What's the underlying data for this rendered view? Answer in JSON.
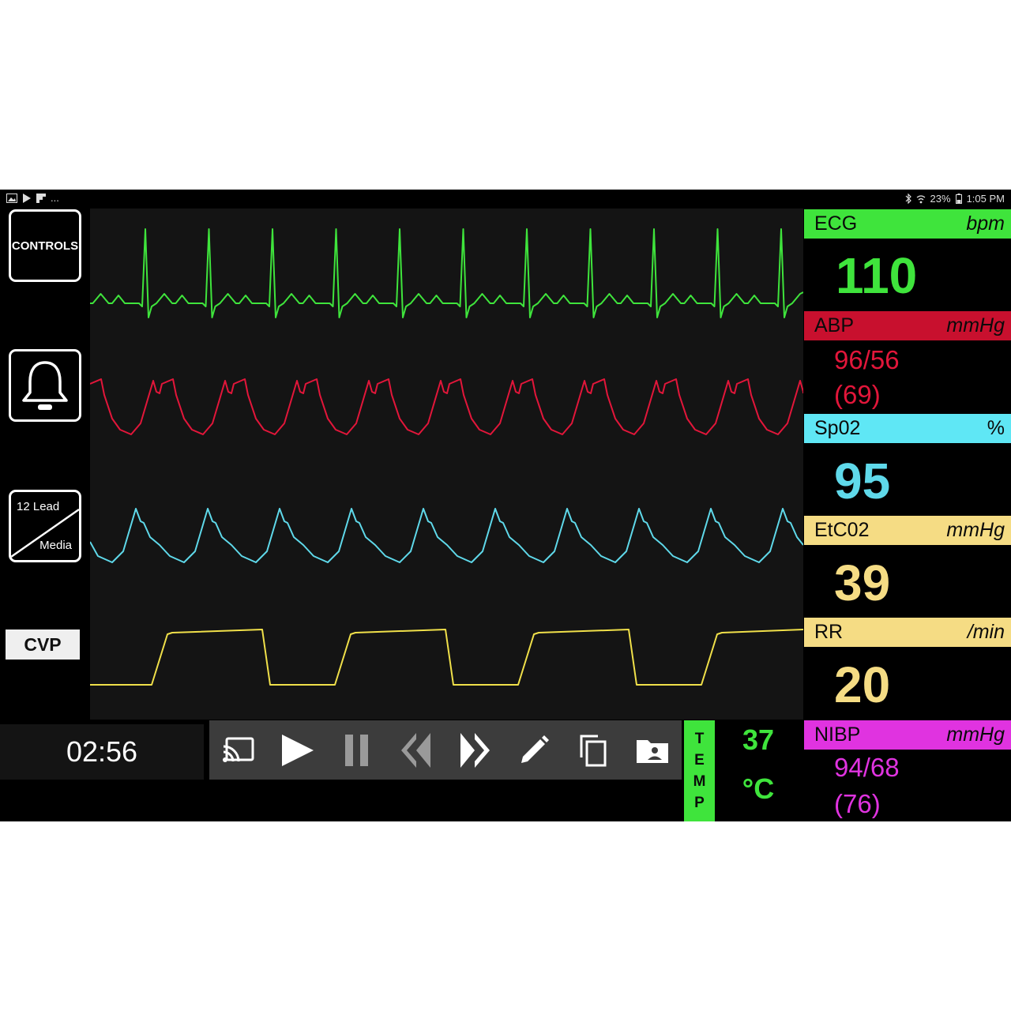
{
  "status_bar": {
    "left_icons": [
      "image-icon",
      "play-store-icon",
      "flipboard-icon"
    ],
    "left_more": "...",
    "right_icons": [
      "bluetooth-icon",
      "wifi-icon",
      "battery-icon"
    ],
    "battery": "23%",
    "time": "1:05 PM"
  },
  "sidebar": {
    "controls_label": "CONTROLS",
    "lead_top": "12 Lead",
    "lead_bottom": "Media",
    "cvp_label": "CVP"
  },
  "waveforms": {
    "colors": {
      "ecg": "#3fe43c",
      "abp": "#e2163a",
      "spo2": "#5fd9ea",
      "cvp": "#f0e04a"
    },
    "beats": {
      "ecg": 12,
      "abp": 10,
      "spo2": 10,
      "cvp": 4
    }
  },
  "timer": "02:56",
  "toolbar_icons": [
    "cast-icon",
    "play-icon",
    "pause-icon",
    "rewind-icon",
    "fast-forward-icon",
    "pencil-icon",
    "copy-icon",
    "folder-contact-icon"
  ],
  "temperature": {
    "label_letters": [
      "T",
      "E",
      "M",
      "P"
    ],
    "value": "37",
    "unit": "°C"
  },
  "vitals": {
    "ecg": {
      "label": "ECG",
      "unit": "bpm",
      "value": "110",
      "color": "#3fe43c"
    },
    "abp": {
      "label": "ABP",
      "unit": "mmHg",
      "value": "96/56",
      "mean": "(69)",
      "color": "#e2163a"
    },
    "spo2": {
      "label": "Sp02",
      "unit": "%",
      "value": "95",
      "color": "#5fd9ea"
    },
    "etco2": {
      "label": "EtC02",
      "unit": "mmHg",
      "value": "39",
      "color": "#f5dc84"
    },
    "rr": {
      "label": "RR",
      "unit": "/min",
      "value": "20",
      "color": "#f5dc84"
    },
    "nibp": {
      "label": "NIBP",
      "unit": "mmHg",
      "value": "94/68",
      "mean": "(76)",
      "color": "#e033e0"
    }
  }
}
